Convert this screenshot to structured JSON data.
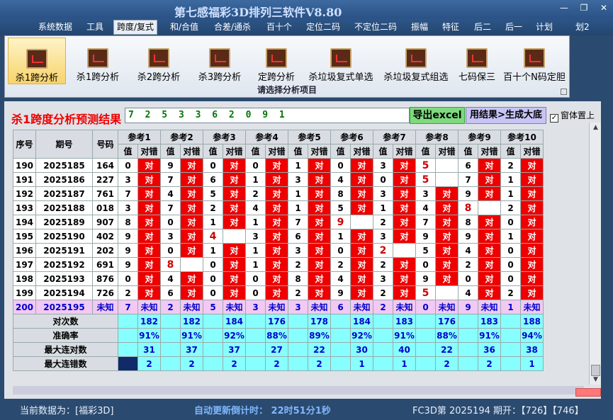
{
  "window": {
    "title": "第七感福彩3D排列三软件V8.80",
    "min": "—",
    "max": "❐",
    "close": "✕"
  },
  "menu": [
    "系统数据",
    "工具",
    "跨度/复式",
    "和/合值",
    "合差/通杀",
    "百十个",
    "定位二码",
    "不定位二码",
    "振幅",
    "特征",
    "后二",
    "后一",
    "计划",
    "划2"
  ],
  "active_menu": "跨度/复式",
  "ribbon": {
    "buttons": [
      "杀1跨分析",
      "杀1跨分析",
      "杀2跨分析",
      "杀3跨分析",
      "定跨分析",
      "杀垃圾复式单选",
      "杀垃圾复式组选",
      "七码保三",
      "百十个N码定胆"
    ],
    "caption": "请选择分析项目"
  },
  "result": {
    "label": "杀1跨度分析预测结果",
    "value": "7 2 5 3 3 6 2 0 9 1"
  },
  "buttons": {
    "export": "导出excel",
    "generate": "用结果>生成大底",
    "topmost": "窗体置上",
    "topmost_checked": "✓"
  },
  "table": {
    "headers": {
      "seq": "序号",
      "period": "期号",
      "code": "号码",
      "refs": [
        "参考1",
        "参考2",
        "参考3",
        "参考4",
        "参考5",
        "参考6",
        "参考7",
        "参考8",
        "参考9",
        "参考10"
      ],
      "val": "值",
      "ok": "对错"
    },
    "rows": [
      {
        "seq": "190",
        "period": "2025185",
        "code": "164",
        "cells": [
          [
            "0",
            "对"
          ],
          [
            "9",
            "对"
          ],
          [
            "0",
            "对"
          ],
          [
            "0",
            "对"
          ],
          [
            "1",
            "对"
          ],
          [
            "0",
            "对"
          ],
          [
            "3",
            "对"
          ],
          [
            "5",
            ""
          ],
          [
            "6",
            "对"
          ],
          [
            "2",
            "对"
          ]
        ]
      },
      {
        "seq": "191",
        "period": "2025186",
        "code": "227",
        "cells": [
          [
            "3",
            "对"
          ],
          [
            "7",
            "对"
          ],
          [
            "6",
            "对"
          ],
          [
            "1",
            "对"
          ],
          [
            "3",
            "对"
          ],
          [
            "4",
            "对"
          ],
          [
            "0",
            "对"
          ],
          [
            "5",
            ""
          ],
          [
            "7",
            "对"
          ],
          [
            "1",
            "对"
          ]
        ]
      },
      {
        "seq": "192",
        "period": "2025187",
        "code": "761",
        "cells": [
          [
            "7",
            "对"
          ],
          [
            "4",
            "对"
          ],
          [
            "5",
            "对"
          ],
          [
            "2",
            "对"
          ],
          [
            "1",
            "对"
          ],
          [
            "8",
            "对"
          ],
          [
            "3",
            "对"
          ],
          [
            "3",
            "对"
          ],
          [
            "9",
            "对"
          ],
          [
            "1",
            "对"
          ]
        ]
      },
      {
        "seq": "193",
        "period": "2025188",
        "code": "018",
        "cells": [
          [
            "3",
            "对"
          ],
          [
            "7",
            "对"
          ],
          [
            "2",
            "对"
          ],
          [
            "4",
            "对"
          ],
          [
            "1",
            "对"
          ],
          [
            "5",
            "对"
          ],
          [
            "1",
            "对"
          ],
          [
            "4",
            "对"
          ],
          [
            "8",
            ""
          ],
          [
            "2",
            "对"
          ]
        ]
      },
      {
        "seq": "194",
        "period": "2025189",
        "code": "907",
        "cells": [
          [
            "8",
            "对"
          ],
          [
            "0",
            "对"
          ],
          [
            "1",
            "对"
          ],
          [
            "1",
            "对"
          ],
          [
            "7",
            "对"
          ],
          [
            "9",
            ""
          ],
          [
            "2",
            "对"
          ],
          [
            "7",
            "对"
          ],
          [
            "8",
            "对"
          ],
          [
            "0",
            "对"
          ]
        ]
      },
      {
        "seq": "195",
        "period": "2025190",
        "code": "402",
        "cells": [
          [
            "9",
            "对"
          ],
          [
            "3",
            "对"
          ],
          [
            "4",
            ""
          ],
          [
            "3",
            "对"
          ],
          [
            "6",
            "对"
          ],
          [
            "1",
            "对"
          ],
          [
            "3",
            "对"
          ],
          [
            "9",
            "对"
          ],
          [
            "9",
            "对"
          ],
          [
            "1",
            "对"
          ]
        ]
      },
      {
        "seq": "196",
        "period": "2025191",
        "code": "202",
        "cells": [
          [
            "9",
            "对"
          ],
          [
            "0",
            "对"
          ],
          [
            "1",
            "对"
          ],
          [
            "1",
            "对"
          ],
          [
            "3",
            "对"
          ],
          [
            "0",
            "对"
          ],
          [
            "2",
            ""
          ],
          [
            "5",
            "对"
          ],
          [
            "4",
            "对"
          ],
          [
            "0",
            "对"
          ]
        ]
      },
      {
        "seq": "197",
        "period": "2025192",
        "code": "691",
        "cells": [
          [
            "9",
            "对"
          ],
          [
            "8",
            ""
          ],
          [
            "0",
            "对"
          ],
          [
            "1",
            "对"
          ],
          [
            "2",
            "对"
          ],
          [
            "2",
            "对"
          ],
          [
            "2",
            "对"
          ],
          [
            "0",
            "对"
          ],
          [
            "2",
            "对"
          ],
          [
            "0",
            "对"
          ]
        ]
      },
      {
        "seq": "198",
        "period": "2025193",
        "code": "876",
        "cells": [
          [
            "0",
            "对"
          ],
          [
            "4",
            "对"
          ],
          [
            "0",
            "对"
          ],
          [
            "0",
            "对"
          ],
          [
            "8",
            "对"
          ],
          [
            "4",
            "对"
          ],
          [
            "3",
            "对"
          ],
          [
            "9",
            "对"
          ],
          [
            "0",
            "对"
          ],
          [
            "0",
            "对"
          ]
        ]
      },
      {
        "seq": "199",
        "period": "2025194",
        "code": "726",
        "cells": [
          [
            "2",
            "对"
          ],
          [
            "6",
            "对"
          ],
          [
            "0",
            "对"
          ],
          [
            "0",
            "对"
          ],
          [
            "2",
            "对"
          ],
          [
            "9",
            "对"
          ],
          [
            "2",
            "对"
          ],
          [
            "5",
            ""
          ],
          [
            "4",
            "对"
          ],
          [
            "2",
            "对"
          ]
        ]
      }
    ],
    "pending": {
      "seq": "200",
      "period": "2025195",
      "code": "未知",
      "cells": [
        [
          "7",
          "未知"
        ],
        [
          "2",
          "未知"
        ],
        [
          "5",
          "未知"
        ],
        [
          "3",
          "未知"
        ],
        [
          "3",
          "未知"
        ],
        [
          "6",
          "未知"
        ],
        [
          "2",
          "未知"
        ],
        [
          "0",
          "未知"
        ],
        [
          "9",
          "未知"
        ],
        [
          "1",
          "未知"
        ]
      ]
    },
    "stats": [
      {
        "label": "对次数",
        "values": [
          "182",
          "182",
          "184",
          "176",
          "178",
          "184",
          "183",
          "176",
          "183",
          "188"
        ]
      },
      {
        "label": "准确率",
        "values": [
          "91%",
          "91%",
          "92%",
          "88%",
          "89%",
          "92%",
          "91%",
          "88%",
          "91%",
          "94%"
        ]
      },
      {
        "label": "最大连对数",
        "values": [
          "31",
          "37",
          "37",
          "27",
          "22",
          "30",
          "40",
          "22",
          "36",
          "38"
        ]
      },
      {
        "label": "最大连错数",
        "values": [
          "2",
          "2",
          "2",
          "2",
          "2",
          "1",
          "1",
          "2",
          "2",
          "1"
        ]
      }
    ]
  },
  "status": {
    "current": "当前数据为：[福彩3D]",
    "timer": "自动更新倒计时：  22时51分1秒",
    "draw": "FC3D第 2025194 期开：【726】【746】"
  }
}
